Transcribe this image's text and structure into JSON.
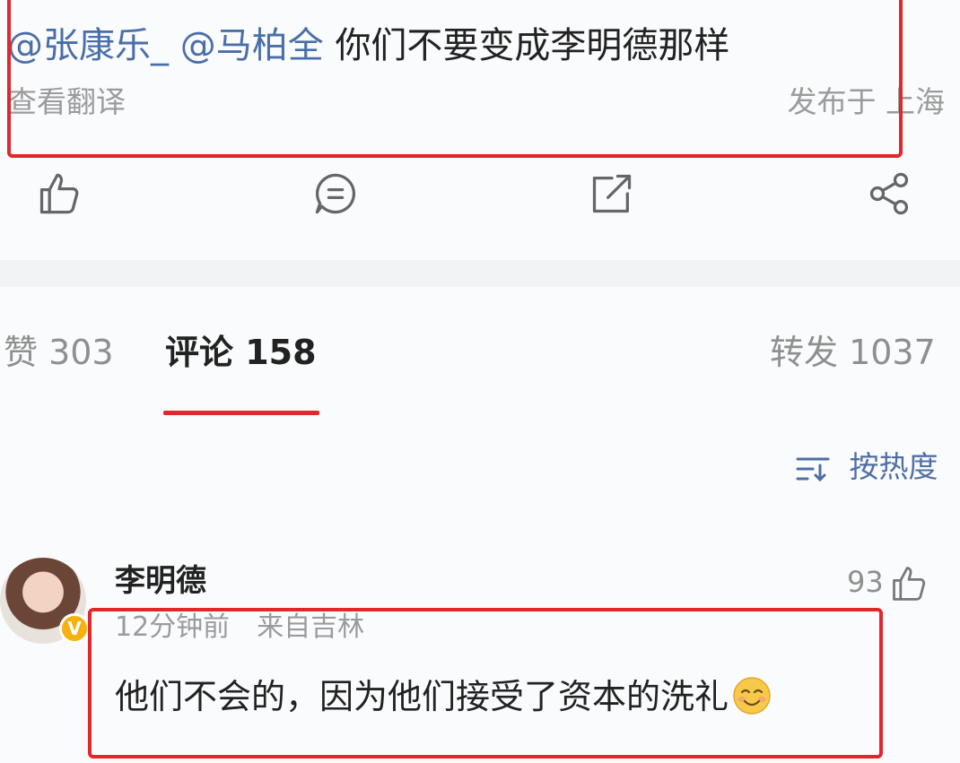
{
  "post": {
    "mentions": [
      "@张康乐_",
      "@马柏全"
    ],
    "text": "你们不要变成李明德那样",
    "translate_label": "查看翻译",
    "location": "发布于 上海"
  },
  "actions": {
    "icons": [
      "thumbs-up-icon",
      "comment-icon",
      "repost-icon",
      "share-icon"
    ]
  },
  "tabs": {
    "likes": "赞 303",
    "comments": "评论 158",
    "reposts": "转发 1037"
  },
  "sort": {
    "label": "按热度",
    "icon": "sort-icon"
  },
  "comment": {
    "user_name": "李明德",
    "likes": "93",
    "time": "12分钟前",
    "source": "来自吉林",
    "text": "他们不会的，因为他们接受了资本的洗礼",
    "emoji": "smiling-emoji"
  },
  "colors": {
    "accent_red": "#e0272b",
    "mention_blue": "#4a6fa8",
    "badge_gold": "#f5b10d"
  }
}
